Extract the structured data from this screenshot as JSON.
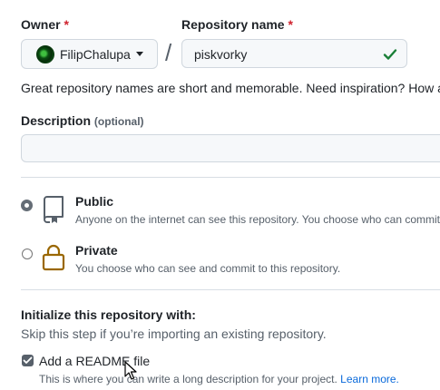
{
  "owner": {
    "label": "Owner",
    "required": "*",
    "value": "FilipChalupa"
  },
  "separator": "/",
  "repo": {
    "label": "Repository name",
    "required": "*",
    "value": "piskvorky"
  },
  "hint": "Great repository names are short and memorable. Need inspiration? How a",
  "description": {
    "label": "Description",
    "optional": "(optional)",
    "value": ""
  },
  "visibility": {
    "public": {
      "title": "Public",
      "sub": "Anyone on the internet can see this repository. You choose who can commit"
    },
    "private": {
      "title": "Private",
      "sub": "You choose who can see and commit to this repository."
    }
  },
  "init": {
    "title": "Initialize this repository with:",
    "sub": "Skip this step if you’re importing an existing repository.",
    "readme": {
      "label": "Add a README file",
      "sub": "This is where you can write a long description for your project.",
      "link": "Learn more."
    }
  },
  "colors": {
    "required": "#cf222e",
    "link": "#0969da",
    "check": "#1a7f37",
    "lock": "#9a6700"
  }
}
